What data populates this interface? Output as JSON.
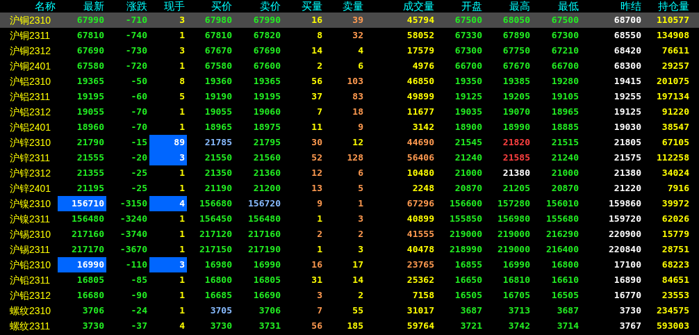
{
  "columns": [
    "名称",
    "最新",
    "涨跌",
    "现手",
    "买价",
    "卖价",
    "买量",
    "卖量",
    "成交量",
    "开盘",
    "最高",
    "最低",
    "昨结",
    "持仓量"
  ],
  "rows": [
    {
      "name": "沪铜2310",
      "selected": true,
      "cells": [
        {
          "text": "67990",
          "color": "#22ee22",
          "highlighted": false
        },
        {
          "text": "-710",
          "color": "#22ee22",
          "highlighted": false
        },
        {
          "text": "3",
          "color": "#ffff00",
          "highlighted": false
        },
        {
          "text": "67980",
          "color": "#22ee22",
          "highlighted": false
        },
        {
          "text": "67990",
          "color": "#22ee22",
          "highlighted": false
        },
        {
          "text": "16",
          "color": "#ffff00",
          "highlighted": false
        },
        {
          "text": "39",
          "color": "#ff9a50",
          "highlighted": false
        },
        {
          "text": "45794",
          "color": "#ffff00",
          "highlighted": false
        },
        {
          "text": "67500",
          "color": "#22ee22",
          "highlighted": false
        },
        {
          "text": "68050",
          "color": "#22ee22",
          "highlighted": false
        },
        {
          "text": "67500",
          "color": "#22ee22",
          "highlighted": false
        },
        {
          "text": "68700",
          "color": "#ffffff",
          "highlighted": false
        },
        {
          "text": "110577",
          "color": "#ffff00",
          "highlighted": false
        }
      ]
    },
    {
      "name": "沪铜2311",
      "selected": false,
      "cells": [
        {
          "text": "67810",
          "color": "#22ee22",
          "highlighted": false
        },
        {
          "text": "-740",
          "color": "#22ee22",
          "highlighted": false
        },
        {
          "text": "1",
          "color": "#ffff00",
          "highlighted": false
        },
        {
          "text": "67810",
          "color": "#22ee22",
          "highlighted": false
        },
        {
          "text": "67820",
          "color": "#22ee22",
          "highlighted": false
        },
        {
          "text": "8",
          "color": "#ffff00",
          "highlighted": false
        },
        {
          "text": "32",
          "color": "#ff9a50",
          "highlighted": false
        },
        {
          "text": "58052",
          "color": "#ffff00",
          "highlighted": false
        },
        {
          "text": "67330",
          "color": "#22ee22",
          "highlighted": false
        },
        {
          "text": "67890",
          "color": "#22ee22",
          "highlighted": false
        },
        {
          "text": "67300",
          "color": "#22ee22",
          "highlighted": false
        },
        {
          "text": "68550",
          "color": "#ffffff",
          "highlighted": false
        },
        {
          "text": "134908",
          "color": "#ffff00",
          "highlighted": false
        }
      ]
    },
    {
      "name": "沪铜2312",
      "selected": false,
      "cells": [
        {
          "text": "67690",
          "color": "#22ee22",
          "highlighted": false
        },
        {
          "text": "-730",
          "color": "#22ee22",
          "highlighted": false
        },
        {
          "text": "3",
          "color": "#ffff00",
          "highlighted": false
        },
        {
          "text": "67670",
          "color": "#22ee22",
          "highlighted": false
        },
        {
          "text": "67690",
          "color": "#22ee22",
          "highlighted": false
        },
        {
          "text": "14",
          "color": "#ffff00",
          "highlighted": false
        },
        {
          "text": "4",
          "color": "#ffff00",
          "highlighted": false
        },
        {
          "text": "17579",
          "color": "#ffff00",
          "highlighted": false
        },
        {
          "text": "67300",
          "color": "#22ee22",
          "highlighted": false
        },
        {
          "text": "67750",
          "color": "#22ee22",
          "highlighted": false
        },
        {
          "text": "67210",
          "color": "#22ee22",
          "highlighted": false
        },
        {
          "text": "68420",
          "color": "#ffffff",
          "highlighted": false
        },
        {
          "text": "76611",
          "color": "#ffff00",
          "highlighted": false
        }
      ]
    },
    {
      "name": "沪铜2401",
      "selected": false,
      "cells": [
        {
          "text": "67580",
          "color": "#22ee22",
          "highlighted": false
        },
        {
          "text": "-720",
          "color": "#22ee22",
          "highlighted": false
        },
        {
          "text": "1",
          "color": "#ffff00",
          "highlighted": false
        },
        {
          "text": "67580",
          "color": "#22ee22",
          "highlighted": false
        },
        {
          "text": "67600",
          "color": "#22ee22",
          "highlighted": false
        },
        {
          "text": "2",
          "color": "#ffff00",
          "highlighted": false
        },
        {
          "text": "6",
          "color": "#ffff00",
          "highlighted": false
        },
        {
          "text": "4976",
          "color": "#ffff00",
          "highlighted": false
        },
        {
          "text": "66700",
          "color": "#22ee22",
          "highlighted": false
        },
        {
          "text": "67670",
          "color": "#22ee22",
          "highlighted": false
        },
        {
          "text": "66700",
          "color": "#22ee22",
          "highlighted": false
        },
        {
          "text": "68300",
          "color": "#ffffff",
          "highlighted": false
        },
        {
          "text": "29257",
          "color": "#ffff00",
          "highlighted": false
        }
      ]
    },
    {
      "name": "沪铝2310",
      "selected": false,
      "cells": [
        {
          "text": "19365",
          "color": "#22ee22",
          "highlighted": false
        },
        {
          "text": "-50",
          "color": "#22ee22",
          "highlighted": false
        },
        {
          "text": "8",
          "color": "#ffff00",
          "highlighted": false
        },
        {
          "text": "19360",
          "color": "#22ee22",
          "highlighted": false
        },
        {
          "text": "19365",
          "color": "#22ee22",
          "highlighted": false
        },
        {
          "text": "56",
          "color": "#ffff00",
          "highlighted": false
        },
        {
          "text": "103",
          "color": "#ff9a50",
          "highlighted": false
        },
        {
          "text": "46850",
          "color": "#ffff00",
          "highlighted": false
        },
        {
          "text": "19350",
          "color": "#22ee22",
          "highlighted": false
        },
        {
          "text": "19385",
          "color": "#22ee22",
          "highlighted": false
        },
        {
          "text": "19280",
          "color": "#22ee22",
          "highlighted": false
        },
        {
          "text": "19415",
          "color": "#ffffff",
          "highlighted": false
        },
        {
          "text": "201075",
          "color": "#ffff00",
          "highlighted": false
        }
      ]
    },
    {
      "name": "沪铝2311",
      "selected": false,
      "cells": [
        {
          "text": "19195",
          "color": "#22ee22",
          "highlighted": false
        },
        {
          "text": "-60",
          "color": "#22ee22",
          "highlighted": false
        },
        {
          "text": "5",
          "color": "#ffff00",
          "highlighted": false
        },
        {
          "text": "19190",
          "color": "#22ee22",
          "highlighted": false
        },
        {
          "text": "19195",
          "color": "#22ee22",
          "highlighted": false
        },
        {
          "text": "37",
          "color": "#ffff00",
          "highlighted": false
        },
        {
          "text": "83",
          "color": "#ff9a50",
          "highlighted": false
        },
        {
          "text": "49899",
          "color": "#ffff00",
          "highlighted": false
        },
        {
          "text": "19125",
          "color": "#22ee22",
          "highlighted": false
        },
        {
          "text": "19205",
          "color": "#22ee22",
          "highlighted": false
        },
        {
          "text": "19105",
          "color": "#22ee22",
          "highlighted": false
        },
        {
          "text": "19255",
          "color": "#ffffff",
          "highlighted": false
        },
        {
          "text": "197134",
          "color": "#ffff00",
          "highlighted": false
        }
      ]
    },
    {
      "name": "沪铝2312",
      "selected": false,
      "cells": [
        {
          "text": "19055",
          "color": "#22ee22",
          "highlighted": false
        },
        {
          "text": "-70",
          "color": "#22ee22",
          "highlighted": false
        },
        {
          "text": "1",
          "color": "#ffff00",
          "highlighted": false
        },
        {
          "text": "19055",
          "color": "#22ee22",
          "highlighted": false
        },
        {
          "text": "19060",
          "color": "#22ee22",
          "highlighted": false
        },
        {
          "text": "7",
          "color": "#ffff00",
          "highlighted": false
        },
        {
          "text": "18",
          "color": "#ff9a50",
          "highlighted": false
        },
        {
          "text": "11677",
          "color": "#ffff00",
          "highlighted": false
        },
        {
          "text": "19035",
          "color": "#22ee22",
          "highlighted": false
        },
        {
          "text": "19070",
          "color": "#22ee22",
          "highlighted": false
        },
        {
          "text": "18965",
          "color": "#22ee22",
          "highlighted": false
        },
        {
          "text": "19125",
          "color": "#ffffff",
          "highlighted": false
        },
        {
          "text": "91220",
          "color": "#ffff00",
          "highlighted": false
        }
      ]
    },
    {
      "name": "沪铝2401",
      "selected": false,
      "cells": [
        {
          "text": "18960",
          "color": "#22ee22",
          "highlighted": false
        },
        {
          "text": "-70",
          "color": "#22ee22",
          "highlighted": false
        },
        {
          "text": "1",
          "color": "#ffff00",
          "highlighted": false
        },
        {
          "text": "18965",
          "color": "#22ee22",
          "highlighted": false
        },
        {
          "text": "18975",
          "color": "#22ee22",
          "highlighted": false
        },
        {
          "text": "11",
          "color": "#ffff00",
          "highlighted": false
        },
        {
          "text": "9",
          "color": "#ff9a50",
          "highlighted": false
        },
        {
          "text": "3142",
          "color": "#ffff00",
          "highlighted": false
        },
        {
          "text": "18900",
          "color": "#22ee22",
          "highlighted": false
        },
        {
          "text": "18990",
          "color": "#22ee22",
          "highlighted": false
        },
        {
          "text": "18885",
          "color": "#22ee22",
          "highlighted": false
        },
        {
          "text": "19030",
          "color": "#ffffff",
          "highlighted": false
        },
        {
          "text": "38547",
          "color": "#ffff00",
          "highlighted": false
        }
      ]
    },
    {
      "name": "沪锌2310",
      "selected": false,
      "cells": [
        {
          "text": "21790",
          "color": "#22ee22",
          "highlighted": false
        },
        {
          "text": "-15",
          "color": "#22ee22",
          "highlighted": false
        },
        {
          "text": "89",
          "color": "#ffffff",
          "highlighted": true
        },
        {
          "text": "21785",
          "color": "#88bbff",
          "highlighted": false
        },
        {
          "text": "21795",
          "color": "#22ee22",
          "highlighted": false
        },
        {
          "text": "30",
          "color": "#ff9a50",
          "highlighted": false
        },
        {
          "text": "12",
          "color": "#ffff00",
          "highlighted": false
        },
        {
          "text": "44690",
          "color": "#ff9a50",
          "highlighted": false
        },
        {
          "text": "21545",
          "color": "#22ee22",
          "highlighted": false
        },
        {
          "text": "21820",
          "color": "#ff4040",
          "highlighted": false
        },
        {
          "text": "21515",
          "color": "#22ee22",
          "highlighted": false
        },
        {
          "text": "21805",
          "color": "#ffffff",
          "highlighted": false
        },
        {
          "text": "67105",
          "color": "#ffff00",
          "highlighted": false
        }
      ]
    },
    {
      "name": "沪锌2311",
      "selected": false,
      "cells": [
        {
          "text": "21555",
          "color": "#22ee22",
          "highlighted": false
        },
        {
          "text": "-20",
          "color": "#22ee22",
          "highlighted": false
        },
        {
          "text": "3",
          "color": "#ffffff",
          "highlighted": true
        },
        {
          "text": "21550",
          "color": "#22ee22",
          "highlighted": false
        },
        {
          "text": "21560",
          "color": "#22ee22",
          "highlighted": false
        },
        {
          "text": "52",
          "color": "#ff9a50",
          "highlighted": false
        },
        {
          "text": "128",
          "color": "#ff9a50",
          "highlighted": false
        },
        {
          "text": "56406",
          "color": "#ff9a50",
          "highlighted": false
        },
        {
          "text": "21240",
          "color": "#22ee22",
          "highlighted": false
        },
        {
          "text": "21585",
          "color": "#ff4040",
          "highlighted": false
        },
        {
          "text": "21240",
          "color": "#22ee22",
          "highlighted": false
        },
        {
          "text": "21575",
          "color": "#ffffff",
          "highlighted": false
        },
        {
          "text": "112258",
          "color": "#ffff00",
          "highlighted": false
        }
      ]
    },
    {
      "name": "沪锌2312",
      "selected": false,
      "cells": [
        {
          "text": "21355",
          "color": "#22ee22",
          "highlighted": false
        },
        {
          "text": "-25",
          "color": "#22ee22",
          "highlighted": false
        },
        {
          "text": "1",
          "color": "#ffff00",
          "highlighted": false
        },
        {
          "text": "21350",
          "color": "#22ee22",
          "highlighted": false
        },
        {
          "text": "21360",
          "color": "#22ee22",
          "highlighted": false
        },
        {
          "text": "12",
          "color": "#ff9a50",
          "highlighted": false
        },
        {
          "text": "6",
          "color": "#ff9a50",
          "highlighted": false
        },
        {
          "text": "10480",
          "color": "#ffff00",
          "highlighted": false
        },
        {
          "text": "21000",
          "color": "#22ee22",
          "highlighted": false
        },
        {
          "text": "21380",
          "color": "#ffffff",
          "highlighted": false
        },
        {
          "text": "21000",
          "color": "#22ee22",
          "highlighted": false
        },
        {
          "text": "21380",
          "color": "#ffffff",
          "highlighted": false
        },
        {
          "text": "34024",
          "color": "#ffff00",
          "highlighted": false
        }
      ]
    },
    {
      "name": "沪锌2401",
      "selected": false,
      "cells": [
        {
          "text": "21195",
          "color": "#22ee22",
          "highlighted": false
        },
        {
          "text": "-25",
          "color": "#22ee22",
          "highlighted": false
        },
        {
          "text": "1",
          "color": "#ffff00",
          "highlighted": false
        },
        {
          "text": "21190",
          "color": "#22ee22",
          "highlighted": false
        },
        {
          "text": "21200",
          "color": "#22ee22",
          "highlighted": false
        },
        {
          "text": "13",
          "color": "#ff9a50",
          "highlighted": false
        },
        {
          "text": "5",
          "color": "#ff9a50",
          "highlighted": false
        },
        {
          "text": "2248",
          "color": "#ffff00",
          "highlighted": false
        },
        {
          "text": "20870",
          "color": "#22ee22",
          "highlighted": false
        },
        {
          "text": "21205",
          "color": "#22ee22",
          "highlighted": false
        },
        {
          "text": "20870",
          "color": "#22ee22",
          "highlighted": false
        },
        {
          "text": "21220",
          "color": "#ffffff",
          "highlighted": false
        },
        {
          "text": "7916",
          "color": "#ffff00",
          "highlighted": false
        }
      ]
    },
    {
      "name": "沪镍2310",
      "selected": false,
      "cells": [
        {
          "text": "156710",
          "color": "#ffffff",
          "highlighted": true
        },
        {
          "text": "-3150",
          "color": "#22ee22",
          "highlighted": false
        },
        {
          "text": "4",
          "color": "#ffffff",
          "highlighted": true
        },
        {
          "text": "156680",
          "color": "#22ee22",
          "highlighted": false
        },
        {
          "text": "156720",
          "color": "#88bbff",
          "highlighted": false
        },
        {
          "text": "9",
          "color": "#ff9a50",
          "highlighted": false
        },
        {
          "text": "1",
          "color": "#ff9a50",
          "highlighted": false
        },
        {
          "text": "67296",
          "color": "#ff9a50",
          "highlighted": false
        },
        {
          "text": "156600",
          "color": "#22ee22",
          "highlighted": false
        },
        {
          "text": "157280",
          "color": "#22ee22",
          "highlighted": false
        },
        {
          "text": "156010",
          "color": "#22ee22",
          "highlighted": false
        },
        {
          "text": "159860",
          "color": "#ffffff",
          "highlighted": false
        },
        {
          "text": "39972",
          "color": "#ffff00",
          "highlighted": false
        }
      ]
    },
    {
      "name": "沪镍2311",
      "selected": false,
      "cells": [
        {
          "text": "156480",
          "color": "#22ee22",
          "highlighted": false
        },
        {
          "text": "-3240",
          "color": "#22ee22",
          "highlighted": false
        },
        {
          "text": "1",
          "color": "#ffff00",
          "highlighted": false
        },
        {
          "text": "156450",
          "color": "#22ee22",
          "highlighted": false
        },
        {
          "text": "156480",
          "color": "#22ee22",
          "highlighted": false
        },
        {
          "text": "1",
          "color": "#ffff00",
          "highlighted": false
        },
        {
          "text": "3",
          "color": "#ff9a50",
          "highlighted": false
        },
        {
          "text": "40899",
          "color": "#ffff00",
          "highlighted": false
        },
        {
          "text": "155850",
          "color": "#22ee22",
          "highlighted": false
        },
        {
          "text": "156980",
          "color": "#22ee22",
          "highlighted": false
        },
        {
          "text": "155680",
          "color": "#22ee22",
          "highlighted": false
        },
        {
          "text": "159720",
          "color": "#ffffff",
          "highlighted": false
        },
        {
          "text": "62026",
          "color": "#ffff00",
          "highlighted": false
        }
      ]
    },
    {
      "name": "沪锡2310",
      "selected": false,
      "cells": [
        {
          "text": "217160",
          "color": "#22ee22",
          "highlighted": false
        },
        {
          "text": "-3740",
          "color": "#22ee22",
          "highlighted": false
        },
        {
          "text": "1",
          "color": "#ffff00",
          "highlighted": false
        },
        {
          "text": "217120",
          "color": "#22ee22",
          "highlighted": false
        },
        {
          "text": "217160",
          "color": "#22ee22",
          "highlighted": false
        },
        {
          "text": "2",
          "color": "#ff9a50",
          "highlighted": false
        },
        {
          "text": "2",
          "color": "#ff9a50",
          "highlighted": false
        },
        {
          "text": "41555",
          "color": "#ff9a50",
          "highlighted": false
        },
        {
          "text": "219000",
          "color": "#22ee22",
          "highlighted": false
        },
        {
          "text": "219000",
          "color": "#22ee22",
          "highlighted": false
        },
        {
          "text": "216290",
          "color": "#22ee22",
          "highlighted": false
        },
        {
          "text": "220900",
          "color": "#ffffff",
          "highlighted": false
        },
        {
          "text": "15779",
          "color": "#ffff00",
          "highlighted": false
        }
      ]
    },
    {
      "name": "沪锡2311",
      "selected": false,
      "cells": [
        {
          "text": "217170",
          "color": "#22ee22",
          "highlighted": false
        },
        {
          "text": "-3670",
          "color": "#22ee22",
          "highlighted": false
        },
        {
          "text": "1",
          "color": "#ffff00",
          "highlighted": false
        },
        {
          "text": "217150",
          "color": "#22ee22",
          "highlighted": false
        },
        {
          "text": "217190",
          "color": "#22ee22",
          "highlighted": false
        },
        {
          "text": "1",
          "color": "#ffff00",
          "highlighted": false
        },
        {
          "text": "3",
          "color": "#ffff00",
          "highlighted": false
        },
        {
          "text": "40478",
          "color": "#ffff00",
          "highlighted": false
        },
        {
          "text": "218990",
          "color": "#22ee22",
          "highlighted": false
        },
        {
          "text": "219000",
          "color": "#22ee22",
          "highlighted": false
        },
        {
          "text": "216400",
          "color": "#22ee22",
          "highlighted": false
        },
        {
          "text": "220840",
          "color": "#ffffff",
          "highlighted": false
        },
        {
          "text": "28751",
          "color": "#ffff00",
          "highlighted": false
        }
      ]
    },
    {
      "name": "沪铅2310",
      "selected": false,
      "cells": [
        {
          "text": "16990",
          "color": "#ffffff",
          "highlighted": true
        },
        {
          "text": "-110",
          "color": "#22ee22",
          "highlighted": false
        },
        {
          "text": "3",
          "color": "#ffffff",
          "highlighted": true
        },
        {
          "text": "16980",
          "color": "#22ee22",
          "highlighted": false
        },
        {
          "text": "16990",
          "color": "#22ee22",
          "highlighted": false
        },
        {
          "text": "16",
          "color": "#ff9a50",
          "highlighted": false
        },
        {
          "text": "17",
          "color": "#ffff00",
          "highlighted": false
        },
        {
          "text": "23765",
          "color": "#ff9a50",
          "highlighted": false
        },
        {
          "text": "16855",
          "color": "#22ee22",
          "highlighted": false
        },
        {
          "text": "16990",
          "color": "#22ee22",
          "highlighted": false
        },
        {
          "text": "16800",
          "color": "#22ee22",
          "highlighted": false
        },
        {
          "text": "17100",
          "color": "#ffffff",
          "highlighted": false
        },
        {
          "text": "68223",
          "color": "#ffff00",
          "highlighted": false
        }
      ]
    },
    {
      "name": "沪铅2311",
      "selected": false,
      "cells": [
        {
          "text": "16805",
          "color": "#22ee22",
          "highlighted": false
        },
        {
          "text": "-85",
          "color": "#22ee22",
          "highlighted": false
        },
        {
          "text": "1",
          "color": "#ffff00",
          "highlighted": false
        },
        {
          "text": "16800",
          "color": "#22ee22",
          "highlighted": false
        },
        {
          "text": "16805",
          "color": "#22ee22",
          "highlighted": false
        },
        {
          "text": "31",
          "color": "#ffff00",
          "highlighted": false
        },
        {
          "text": "14",
          "color": "#ffff00",
          "highlighted": false
        },
        {
          "text": "25362",
          "color": "#ffff00",
          "highlighted": false
        },
        {
          "text": "16650",
          "color": "#22ee22",
          "highlighted": false
        },
        {
          "text": "16810",
          "color": "#22ee22",
          "highlighted": false
        },
        {
          "text": "16610",
          "color": "#22ee22",
          "highlighted": false
        },
        {
          "text": "16890",
          "color": "#ffffff",
          "highlighted": false
        },
        {
          "text": "84651",
          "color": "#ffff00",
          "highlighted": false
        }
      ]
    },
    {
      "name": "沪铅2312",
      "selected": false,
      "cells": [
        {
          "text": "16680",
          "color": "#22ee22",
          "highlighted": false
        },
        {
          "text": "-90",
          "color": "#22ee22",
          "highlighted": false
        },
        {
          "text": "1",
          "color": "#ffff00",
          "highlighted": false
        },
        {
          "text": "16685",
          "color": "#22ee22",
          "highlighted": false
        },
        {
          "text": "16690",
          "color": "#22ee22",
          "highlighted": false
        },
        {
          "text": "3",
          "color": "#ff9a50",
          "highlighted": false
        },
        {
          "text": "2",
          "color": "#ffff00",
          "highlighted": false
        },
        {
          "text": "7158",
          "color": "#ffff00",
          "highlighted": false
        },
        {
          "text": "16505",
          "color": "#22ee22",
          "highlighted": false
        },
        {
          "text": "16705",
          "color": "#22ee22",
          "highlighted": false
        },
        {
          "text": "16505",
          "color": "#22ee22",
          "highlighted": false
        },
        {
          "text": "16770",
          "color": "#ffffff",
          "highlighted": false
        },
        {
          "text": "23553",
          "color": "#ffff00",
          "highlighted": false
        }
      ]
    },
    {
      "name": "螺纹2310",
      "selected": false,
      "cells": [
        {
          "text": "3706",
          "color": "#22ee22",
          "highlighted": false
        },
        {
          "text": "-24",
          "color": "#22ee22",
          "highlighted": false
        },
        {
          "text": "1",
          "color": "#ffff00",
          "highlighted": false
        },
        {
          "text": "3705",
          "color": "#88bbff",
          "highlighted": false
        },
        {
          "text": "3706",
          "color": "#22ee22",
          "highlighted": false
        },
        {
          "text": "7",
          "color": "#ff9a50",
          "highlighted": false
        },
        {
          "text": "55",
          "color": "#ffff00",
          "highlighted": false
        },
        {
          "text": "31017",
          "color": "#ffff00",
          "highlighted": false
        },
        {
          "text": "3687",
          "color": "#22ee22",
          "highlighted": false
        },
        {
          "text": "3713",
          "color": "#22ee22",
          "highlighted": false
        },
        {
          "text": "3687",
          "color": "#22ee22",
          "highlighted": false
        },
        {
          "text": "3730",
          "color": "#ffffff",
          "highlighted": false
        },
        {
          "text": "234575",
          "color": "#ffff00",
          "highlighted": false
        }
      ]
    },
    {
      "name": "螺纹2311",
      "selected": false,
      "cells": [
        {
          "text": "3730",
          "color": "#22ee22",
          "highlighted": false
        },
        {
          "text": "-37",
          "color": "#22ee22",
          "highlighted": false
        },
        {
          "text": "4",
          "color": "#ffff00",
          "highlighted": false
        },
        {
          "text": "3730",
          "color": "#22ee22",
          "highlighted": false
        },
        {
          "text": "3731",
          "color": "#22ee22",
          "highlighted": false
        },
        {
          "text": "56",
          "color": "#ff9a50",
          "highlighted": false
        },
        {
          "text": "185",
          "color": "#ffff00",
          "highlighted": false
        },
        {
          "text": "59764",
          "color": "#ffff00",
          "highlighted": false
        },
        {
          "text": "3721",
          "color": "#22ee22",
          "highlighted": false
        },
        {
          "text": "3742",
          "color": "#22ee22",
          "highlighted": false
        },
        {
          "text": "3714",
          "color": "#22ee22",
          "highlighted": false
        },
        {
          "text": "3767",
          "color": "#ffffff",
          "highlighted": false
        },
        {
          "text": "593003",
          "color": "#ffff00",
          "highlighted": false
        }
      ]
    }
  ]
}
